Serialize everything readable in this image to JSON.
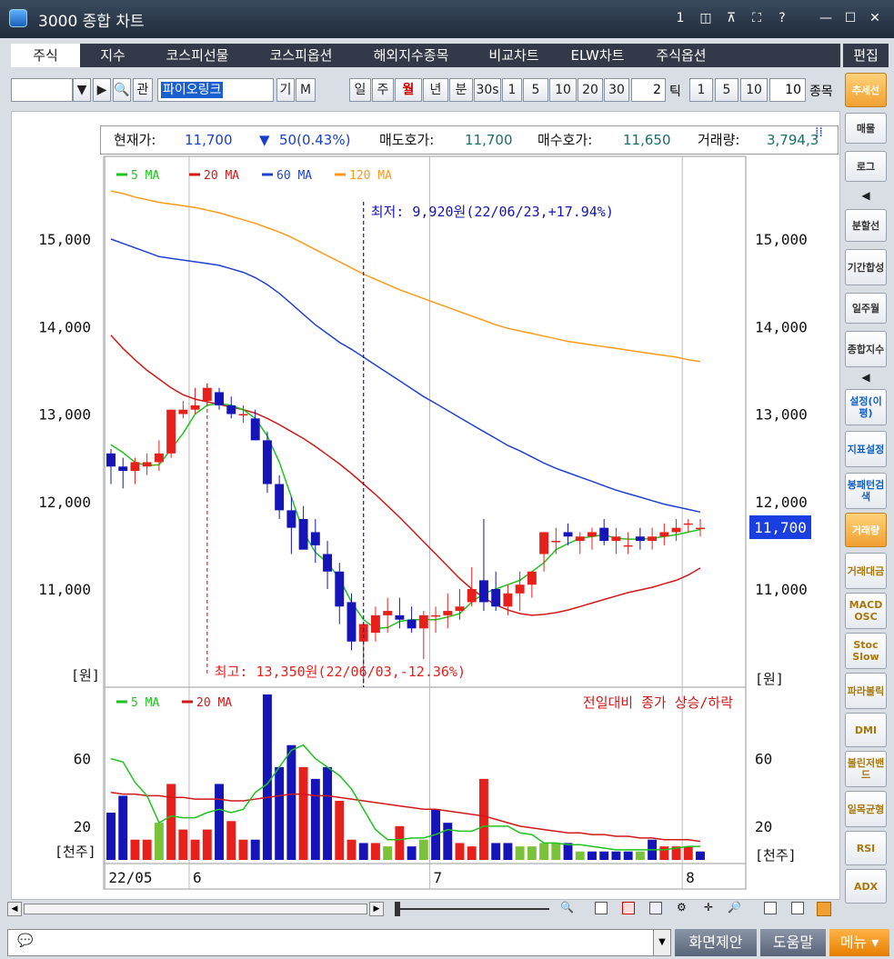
{
  "window": {
    "title": "3000 종합 차트",
    "buttons": [
      "1",
      "◫",
      "⊼",
      "⛶",
      "?",
      "—",
      "☐",
      "✕"
    ]
  },
  "tabs": [
    "주식",
    "지수",
    "코스피선물",
    "코스피옵션",
    "해외지수종목",
    "비교차트",
    "ELW차트",
    "주식옵션"
  ],
  "edit_label": "편집",
  "toolbar": {
    "code_value": "",
    "stock_name": "파이오링크",
    "gi": "기",
    "m": "M",
    "gwan": "관",
    "periods": [
      "일",
      "주",
      "월",
      "년",
      "분",
      "30s",
      "1",
      "5",
      "10",
      "20",
      "30"
    ],
    "selected_period": "월",
    "tick_count": "2",
    "tick_label": "틱",
    "tick_periods": [
      "1",
      "5",
      "10"
    ],
    "count_value": "10",
    "jong": "종목"
  },
  "info": {
    "cur_label": "현재가:",
    "cur_value": "11,700",
    "change_value": "50(0.43%)",
    "ask_label": "매도호가:",
    "ask_value": "11,700",
    "bid_label": "매수호가:",
    "bid_value": "11,650",
    "vol_label": "거래량:",
    "vol_value": "3,794,3"
  },
  "price_legend": [
    "5 MA",
    "20 MA",
    "60 MA",
    "120 MA"
  ],
  "volume_legend": [
    "5 MA",
    "20 MA"
  ],
  "volume_title": "전일대비 종가 상승/하락",
  "annotations": {
    "low": "최저: 9,920원(22/06/23,+17.94%)",
    "high": "최고: 13,350원(22/06/03,-12.36%)"
  },
  "price_axis_unit": "[원]",
  "volume_axis_unit": "[천주]",
  "price_axis": [
    "15,000",
    "14,000",
    "13,000",
    "12,000",
    "11,000"
  ],
  "volume_axis": [
    "60",
    "20"
  ],
  "current_price_tag": "11,700",
  "x_labels": [
    "22/05",
    "6",
    "7",
    "8"
  ],
  "colors": {
    "up": "#e8201c",
    "down": "#1414b8",
    "ma5": "#1fc21f",
    "ma20": "#d01818",
    "ma60": "#2040d0",
    "ma120": "#ff9a1a",
    "neutral": "#7ac23a"
  },
  "chart_data": {
    "type": "candlestick",
    "dates": [
      "22/05/23",
      "22/05/24",
      "22/05/25",
      "22/05/26",
      "22/05/27",
      "22/05/30",
      "22/05/31",
      "22/06/02",
      "22/06/03",
      "22/06/07",
      "22/06/08",
      "22/06/09",
      "22/06/10",
      "22/06/13",
      "22/06/14",
      "22/06/15",
      "22/06/16",
      "22/06/17",
      "22/06/20",
      "22/06/21",
      "22/06/22",
      "22/06/23",
      "22/06/24",
      "22/06/27",
      "22/06/28",
      "22/06/29",
      "22/06/30",
      "22/07/01",
      "22/07/04",
      "22/07/05",
      "22/07/06",
      "22/07/07",
      "22/07/08",
      "22/07/11",
      "22/07/12",
      "22/07/13",
      "22/07/14",
      "22/07/15",
      "22/07/18",
      "22/07/19",
      "22/07/20",
      "22/07/21",
      "22/07/22",
      "22/07/25",
      "22/07/26",
      "22/07/27",
      "22/07/28",
      "22/07/29",
      "22/08/01",
      "22/08/02"
    ],
    "open": [
      12550,
      12400,
      12350,
      12400,
      12450,
      12550,
      13000,
      13050,
      13150,
      13250,
      13100,
      13000,
      12950,
      12700,
      12200,
      11900,
      11800,
      11650,
      11400,
      11200,
      10850,
      10400,
      10500,
      10700,
      10700,
      10650,
      10550,
      10700,
      10700,
      10750,
      10850,
      11100,
      11000,
      10800,
      10950,
      11050,
      11400,
      11550,
      11650,
      11550,
      11600,
      11700,
      11550,
      11500,
      11600,
      11550,
      11600,
      11650,
      11750,
      11700
    ],
    "high": [
      12600,
      12500,
      12500,
      12550,
      12700,
      13050,
      13150,
      13300,
      13350,
      13300,
      13200,
      13100,
      13050,
      12800,
      12300,
      12050,
      11950,
      11800,
      11550,
      11300,
      10950,
      10600,
      10800,
      10900,
      10900,
      10800,
      10750,
      10800,
      10950,
      11000,
      11250,
      11800,
      11200,
      11050,
      11200,
      11200,
      11650,
      11700,
      11750,
      11650,
      11700,
      11800,
      11700,
      11650,
      11700,
      11700,
      11750,
      11800,
      11800,
      11800
    ],
    "low": [
      12200,
      12150,
      12200,
      12300,
      12350,
      12500,
      12950,
      13000,
      13100,
      13050,
      12950,
      12900,
      12800,
      12100,
      11800,
      11400,
      11500,
      11300,
      11000,
      10600,
      10300,
      9920,
      10400,
      10500,
      10550,
      10500,
      10200,
      10500,
      10550,
      10650,
      10800,
      10750,
      10750,
      10700,
      10750,
      10900,
      11200,
      11400,
      11500,
      11400,
      11450,
      11500,
      11400,
      11400,
      11450,
      11450,
      11500,
      11550,
      11650,
      11600
    ],
    "close": [
      12400,
      12350,
      12450,
      12450,
      12550,
      13050,
      13050,
      13100,
      13300,
      13100,
      13000,
      13000,
      12700,
      12200,
      11900,
      11700,
      11450,
      11500,
      11200,
      10800,
      10400,
      10600,
      10700,
      10750,
      10650,
      10550,
      10700,
      10700,
      10750,
      10800,
      11000,
      10850,
      10800,
      10950,
      11050,
      11200,
      11650,
      11550,
      11600,
      11600,
      11650,
      11550,
      11600,
      11500,
      11550,
      11600,
      11650,
      11700,
      11750,
      11700
    ],
    "volume": [
      28,
      38,
      12,
      12,
      22,
      45,
      18,
      12,
      18,
      45,
      23,
      12,
      12,
      98,
      55,
      68,
      55,
      48,
      55,
      35,
      12,
      10,
      10,
      8,
      20,
      8,
      12,
      30,
      22,
      10,
      8,
      48,
      10,
      10,
      8,
      8,
      10,
      10,
      10,
      5,
      5,
      5,
      5,
      5,
      5,
      12,
      8,
      8,
      8,
      5
    ],
    "volume_up": [
      false,
      false,
      true,
      true,
      null,
      true,
      true,
      true,
      true,
      false,
      true,
      true,
      false,
      false,
      false,
      false,
      true,
      false,
      false,
      true,
      true,
      false,
      true,
      null,
      true,
      false,
      null,
      false,
      false,
      true,
      true,
      true,
      false,
      false,
      null,
      null,
      null,
      null,
      false,
      null,
      false,
      false,
      false,
      false,
      null,
      false,
      true,
      true,
      true,
      false
    ],
    "ylim": [
      10200,
      15500
    ],
    "yticks": [
      11000,
      12000,
      13000,
      14000,
      15000
    ],
    "vol_ylim": [
      0,
      98
    ],
    "ma": {
      "ma5": [
        12650,
        12560,
        12450,
        12410,
        12420,
        12600,
        12780,
        13000,
        13100,
        13120,
        13100,
        13050,
        12950,
        12750,
        12450,
        12050,
        11650,
        11420,
        11300,
        11120,
        10850,
        10650,
        10550,
        10560,
        10630,
        10650,
        10650,
        10650,
        10680,
        10720,
        10850,
        10950,
        11000,
        11050,
        11100,
        11200,
        11300,
        11450,
        11520,
        11580,
        11600,
        11620,
        11580,
        11570,
        11570,
        11580,
        11600,
        11620,
        11650,
        11680
      ],
      "ma20": [
        13900,
        13750,
        13620,
        13500,
        13400,
        13300,
        13220,
        13170,
        13140,
        13110,
        13080,
        13050,
        13010,
        12950,
        12880,
        12800,
        12720,
        12630,
        12530,
        12430,
        12320,
        12200,
        12080,
        11950,
        11820,
        11680,
        11540,
        11400,
        11260,
        11120,
        11000,
        10900,
        10820,
        10760,
        10720,
        10700,
        10710,
        10730,
        10760,
        10800,
        10840,
        10880,
        10920,
        10960,
        10990,
        11020,
        11060,
        11100,
        11160,
        11240
      ],
      "ma60": [
        15000,
        14950,
        14900,
        14850,
        14800,
        14780,
        14760,
        14740,
        14720,
        14700,
        14660,
        14620,
        14560,
        14480,
        14380,
        14260,
        14140,
        14020,
        13920,
        13820,
        13740,
        13650,
        13560,
        13470,
        13380,
        13290,
        13200,
        13120,
        13040,
        12960,
        12880,
        12800,
        12720,
        12640,
        12580,
        12510,
        12440,
        12380,
        12330,
        12280,
        12230,
        12180,
        12130,
        12090,
        12050,
        12010,
        11970,
        11940,
        11910,
        11880
      ],
      "ma120": [
        15550,
        15520,
        15480,
        15450,
        15420,
        15400,
        15380,
        15360,
        15330,
        15300,
        15260,
        15220,
        15180,
        15130,
        15080,
        15020,
        14950,
        14880,
        14810,
        14740,
        14670,
        14600,
        14540,
        14480,
        14420,
        14370,
        14320,
        14270,
        14220,
        14170,
        14120,
        14070,
        14020,
        13980,
        13950,
        13920,
        13890,
        13860,
        13830,
        13810,
        13790,
        13770,
        13750,
        13730,
        13710,
        13690,
        13670,
        13650,
        13620,
        13600
      ]
    },
    "vol_ma": {
      "ma5": [
        60,
        58,
        46,
        38,
        22,
        26,
        25,
        25,
        28,
        30,
        28,
        30,
        40,
        45,
        55,
        65,
        68,
        60,
        55,
        50,
        42,
        30,
        18,
        12,
        12,
        13,
        13,
        15,
        18,
        17,
        17,
        20,
        20,
        20,
        16,
        15,
        10,
        10,
        9,
        9,
        8,
        7,
        6,
        6,
        6,
        6,
        6,
        7,
        8,
        8
      ],
      "ma20": [
        40,
        39,
        39,
        38,
        38,
        37,
        37,
        36,
        36,
        36,
        35,
        35,
        36,
        37,
        38,
        39,
        39,
        38,
        38,
        37,
        36,
        35,
        34,
        33,
        32,
        31,
        30,
        30,
        29,
        28,
        27,
        26,
        24,
        22,
        20,
        19,
        18,
        17,
        16,
        16,
        15,
        15,
        14,
        14,
        13,
        13,
        12,
        12,
        12,
        11
      ]
    },
    "annotations": {
      "low": {
        "date": "22/06/23",
        "price": 9920
      },
      "high": {
        "date": "22/06/03",
        "price": 13350
      }
    }
  },
  "sidebar": [
    "추세선",
    "매물",
    "로그",
    "◀",
    "분할선",
    "기간합성",
    "일주월",
    "종합지수",
    "◀",
    "설정(이평)",
    "지표설정",
    "봉패턴검색",
    "거래량",
    "거래대금",
    "MACD OSC",
    "Stoc Slow",
    "파라볼릭",
    "DMI",
    "볼린저밴드",
    "일목균형",
    "RSI",
    "ADX"
  ],
  "status": {
    "chat_placeholder": "",
    "btn_screen": "화면제안",
    "btn_help": "도움말",
    "btn_menu": "메뉴"
  }
}
